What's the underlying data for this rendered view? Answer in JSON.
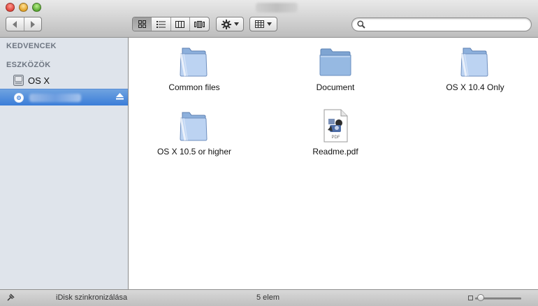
{
  "window": {
    "title": ""
  },
  "toolbar": {
    "back_icon": "chevron-left-icon",
    "forward_icon": "chevron-right-icon",
    "view_modes": [
      {
        "name": "icon-view",
        "icon": "grid-icon",
        "active": true
      },
      {
        "name": "list-view",
        "icon": "list-icon",
        "active": false
      },
      {
        "name": "column-view",
        "icon": "columns-icon",
        "active": false
      },
      {
        "name": "coverflow-view",
        "icon": "coverflow-icon",
        "active": false
      }
    ],
    "action_icon": "gear-icon",
    "arrange_icon": "arrange-grid-icon",
    "search": {
      "value": "",
      "placeholder": ""
    }
  },
  "sidebar": {
    "favorites_header": "KEDVENCEK",
    "devices_header": "ESZKÖZÖK",
    "devices": [
      {
        "label": "OS X",
        "icon": "hard-drive-icon",
        "selected": false
      },
      {
        "label": "",
        "icon": "disc-icon",
        "selected": true,
        "eject": true
      }
    ]
  },
  "content": {
    "items": [
      {
        "name": "Common files",
        "type": "folder"
      },
      {
        "name": "Document",
        "type": "folder-plain"
      },
      {
        "name": "OS X 10.4 Only",
        "type": "folder"
      },
      {
        "name": "OS X 10.5 or higher",
        "type": "folder"
      },
      {
        "name": "Readme.pdf",
        "type": "pdf"
      }
    ],
    "pdf_badge": "PDF"
  },
  "statusbar": {
    "sync_label": "iDisk szinkronizálása",
    "item_count": "5 elem",
    "zoom_level": 0.05
  },
  "colors": {
    "selection": "#3b7dd8",
    "sidebar_bg": "#dfe4eb"
  }
}
